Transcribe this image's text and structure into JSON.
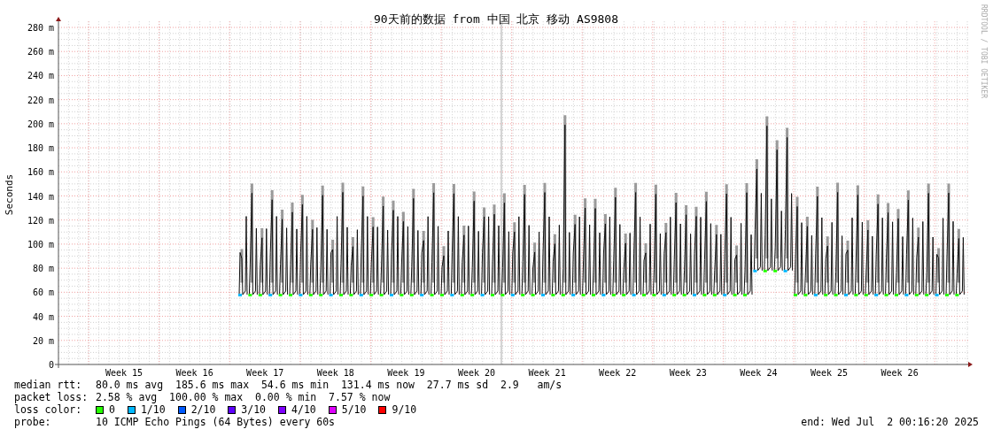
{
  "chart": {
    "title": "90天前的数据 from 中国 北京 移动 AS9808",
    "watermark": "RRDTOOL / TOBI OETIKER",
    "y_axis": {
      "label": "Seconds",
      "ticks": [
        "280 m",
        "260 m",
        "240 m",
        "220 m",
        "200 m",
        "180 m",
        "160 m",
        "140 m",
        "120 m",
        "100 m",
        "80 m",
        "60 m",
        "40 m",
        "20 m",
        "0"
      ]
    },
    "x_axis": {
      "ticks": [
        "Week 15",
        "Week 16",
        "Week 17",
        "Week 18",
        "Week 19",
        "Week 20",
        "Week 21",
        "Week 22",
        "Week 23",
        "Week 24",
        "Week 25",
        "Week 26"
      ]
    }
  },
  "legend": {
    "stats": [
      {
        "label": "median rtt:",
        "text": "80.0 ms avg  185.6 ms max  54.6 ms min  131.4 ms now  27.7 ms sd  2.9   am/s"
      },
      {
        "label": "packet loss:",
        "text": "2.58 % avg  100.00 % max  0.00 % min  7.57 % now"
      }
    ],
    "loss_label": "loss color:",
    "loss_colors": [
      {
        "label": "0",
        "color": "#26ff00"
      },
      {
        "label": "1/10",
        "color": "#00b8ff"
      },
      {
        "label": "2/10",
        "color": "#0059ff"
      },
      {
        "label": "3/10",
        "color": "#5e00ff"
      },
      {
        "label": "4/10",
        "color": "#7e00ff"
      },
      {
        "label": "5/10",
        "color": "#dd00ff"
      },
      {
        "label": "9/10",
        "color": "#ff0000"
      }
    ],
    "probe_label": "probe:",
    "probe": "10 ICMP Echo Pings (64 Bytes) every 60s",
    "end": "end: Wed Jul  2 00:16:20 2025"
  }
}
